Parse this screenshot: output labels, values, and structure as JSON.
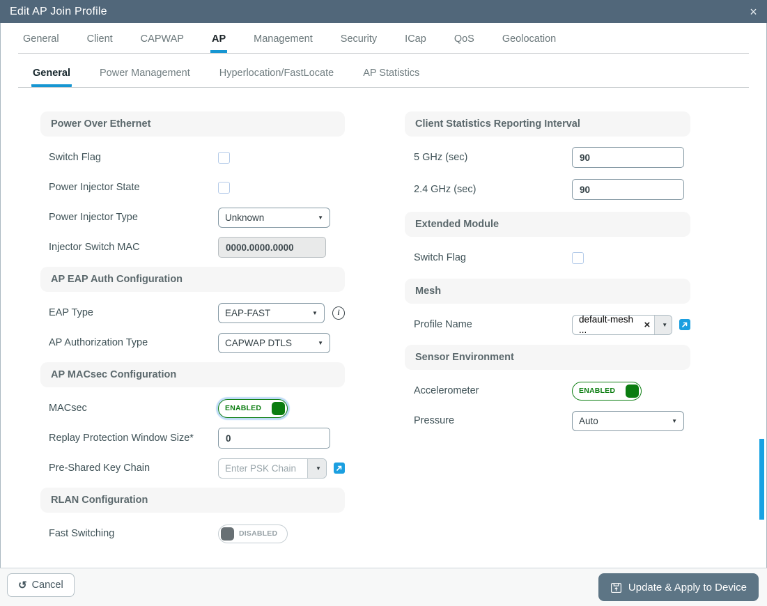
{
  "header": {
    "title": "Edit AP Join Profile"
  },
  "icons": {
    "close": "×",
    "caret": "▼",
    "clear": "×",
    "undo": "↺",
    "info": "i"
  },
  "main_tabs": {
    "active": "AP",
    "items": [
      "General",
      "Client",
      "CAPWAP",
      "AP",
      "Management",
      "Security",
      "ICap",
      "QoS",
      "Geolocation"
    ]
  },
  "sub_tabs": {
    "active": "General",
    "items": [
      "General",
      "Power Management",
      "Hyperlocation/FastLocate",
      "AP Statistics"
    ]
  },
  "sections": {
    "poe": {
      "title": "Power Over Ethernet",
      "switch_flag_label": "Switch Flag",
      "switch_flag_checked": false,
      "power_injector_state_label": "Power Injector State",
      "power_injector_state_checked": false,
      "power_injector_type_label": "Power Injector Type",
      "power_injector_type_value": "Unknown",
      "injector_switch_mac_label": "Injector Switch MAC",
      "injector_switch_mac_value": "0000.0000.0000",
      "injector_switch_mac_disabled": true
    },
    "eap": {
      "title": "AP EAP Auth Configuration",
      "eap_type_label": "EAP Type",
      "eap_type_value": "EAP-FAST",
      "ap_authorization_type_label": "AP Authorization Type",
      "ap_authorization_type_value": "CAPWAP DTLS"
    },
    "macsec": {
      "title": "AP MACsec Configuration",
      "macsec_label": "MACsec",
      "macsec_state": "ENABLED",
      "replay_label": "Replay Protection Window Size*",
      "replay_value": "0",
      "psk_label": "Pre-Shared Key Chain",
      "psk_placeholder": "Enter PSK Chain"
    },
    "rlan": {
      "title": "RLAN Configuration",
      "fast_switching_label": "Fast Switching",
      "fast_switching_state": "DISABLED"
    },
    "client_stats": {
      "title": "Client Statistics Reporting Interval",
      "ghz5_label": "5 GHz (sec)",
      "ghz5_value": "90",
      "ghz24_label": "2.4 GHz (sec)",
      "ghz24_value": "90"
    },
    "extended_module": {
      "title": "Extended Module",
      "switch_flag_label": "Switch Flag",
      "switch_flag_checked": false
    },
    "mesh": {
      "title": "Mesh",
      "profile_name_label": "Profile Name",
      "profile_name_value": "default-mesh ..."
    },
    "sensor": {
      "title": "Sensor Environment",
      "accelerometer_label": "Accelerometer",
      "accelerometer_state": "ENABLED",
      "pressure_label": "Pressure",
      "pressure_value": "Auto"
    }
  },
  "footer": {
    "cancel_label": "Cancel",
    "apply_label": "Update & Apply to Device"
  },
  "colors": {
    "titlebar": "#51677a",
    "accent_blue": "#1796d2",
    "enabled_green": "#0b7d10",
    "link_blue": "#1b9fe0",
    "apply_button": "#5d7585",
    "scrollbar_blue": "#18a2e2"
  }
}
